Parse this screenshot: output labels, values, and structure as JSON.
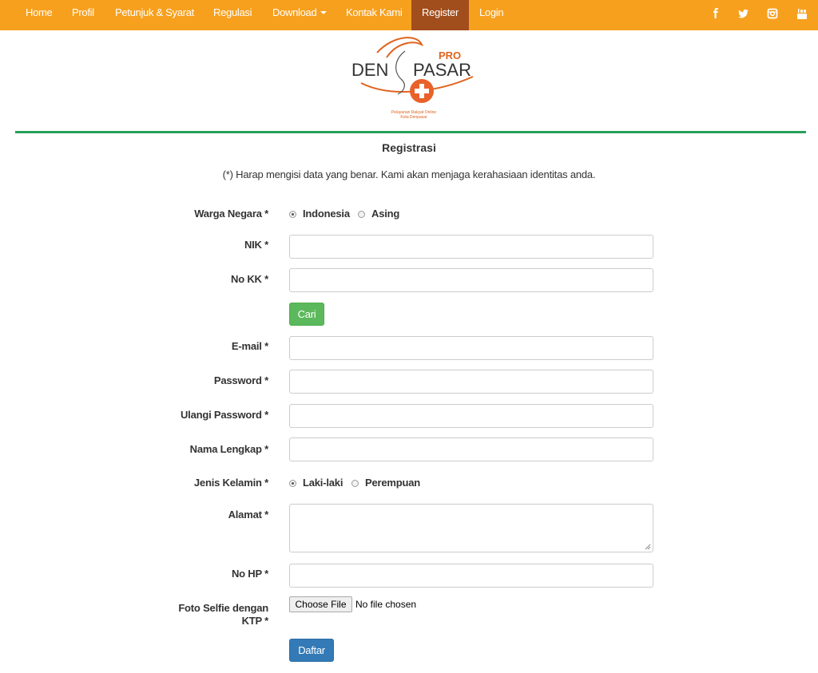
{
  "nav": {
    "items": [
      "Home",
      "Profil",
      "Petunjuk & Syarat",
      "Regulasi",
      "Download",
      "Kontak Kami",
      "Register",
      "Login"
    ],
    "active": "Register",
    "social_icons": [
      "facebook-icon",
      "twitter-icon",
      "instagram-icon",
      "youtube-icon"
    ]
  },
  "logo": {
    "pro": "PRO",
    "den": "DEN",
    "pasar": "PASAR",
    "tagline1": "Pelayanan Rakyat Online",
    "tagline2": "Kota Denpasar"
  },
  "title": "Registrasi",
  "note": "(*) Harap mengisi data yang benar. Kami akan menjaga kerahasiaan identitas anda.",
  "form": {
    "warga_negara": {
      "label": "Warga Negara *",
      "options": [
        "Indonesia",
        "Asing"
      ],
      "selected": "Indonesia"
    },
    "nik": {
      "label": "NIK *",
      "value": ""
    },
    "no_kk": {
      "label": "No KK *",
      "value": ""
    },
    "cari_button": "Cari",
    "email": {
      "label": "E-mail *",
      "value": ""
    },
    "password": {
      "label": "Password *",
      "value": ""
    },
    "ulangi_password": {
      "label": "Ulangi Password *",
      "value": ""
    },
    "nama_lengkap": {
      "label": "Nama Lengkap *",
      "value": ""
    },
    "jenis_kelamin": {
      "label": "Jenis Kelamin *",
      "options": [
        "Laki-laki",
        "Perempuan"
      ],
      "selected": "Laki-laki"
    },
    "alamat": {
      "label": "Alamat *",
      "value": ""
    },
    "no_hp": {
      "label": "No HP *",
      "value": ""
    },
    "foto": {
      "label_line1": "Foto Selfie dengan",
      "label_line2": "KTP *",
      "button": "Choose File",
      "status": "No file chosen"
    },
    "daftar_button": "Daftar"
  },
  "colors": {
    "nav_bg": "#f7a01e",
    "nav_active": "#a14d1c",
    "divider": "#27a05a",
    "cari": "#5cb85c",
    "daftar": "#337ab7"
  }
}
